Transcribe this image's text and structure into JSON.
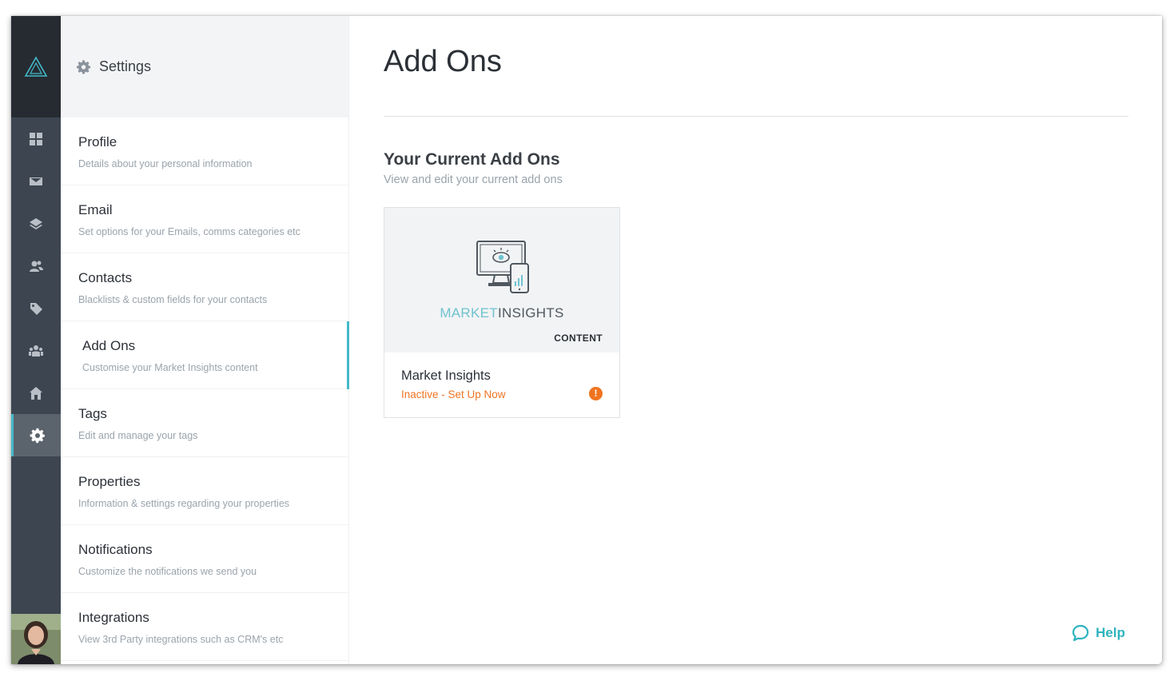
{
  "sidebar": {
    "title": "Settings",
    "items": [
      {
        "label": "Profile",
        "desc": "Details about your personal information"
      },
      {
        "label": "Email",
        "desc": "Set options for your Emails, comms categories etc"
      },
      {
        "label": "Contacts",
        "desc": "Blacklists & custom fields for your contacts"
      },
      {
        "label": "Add Ons",
        "desc": "Customise your Market Insights content"
      },
      {
        "label": "Tags",
        "desc": "Edit and manage your tags"
      },
      {
        "label": "Properties",
        "desc": "Information & settings regarding your properties"
      },
      {
        "label": "Notifications",
        "desc": "Customize the notifications we send you"
      },
      {
        "label": "Integrations",
        "desc": "View 3rd Party integrations such as CRM's etc"
      }
    ],
    "active_item": "Add Ons"
  },
  "rail": {
    "icons": [
      "grid-icon",
      "mail-icon",
      "layers-icon",
      "contacts-icon",
      "tag-icon",
      "team-icon",
      "home-icon",
      "gear-icon"
    ],
    "active": "gear-icon"
  },
  "main": {
    "title": "Add Ons",
    "section_title": "Your Current Add Ons",
    "section_subtitle": "View and edit your current add ons",
    "addon": {
      "brand_light": "MARKET",
      "brand_dark": "INSIGHTS",
      "category": "CONTENT",
      "name": "Market Insights",
      "status": "Inactive - Set Up Now",
      "warn_glyph": "!"
    },
    "help_label": "Help"
  },
  "colors": {
    "accent": "#44b9c8",
    "warning": "#ef7421",
    "rail": "#3d4650",
    "rail_dark": "#262b32"
  }
}
